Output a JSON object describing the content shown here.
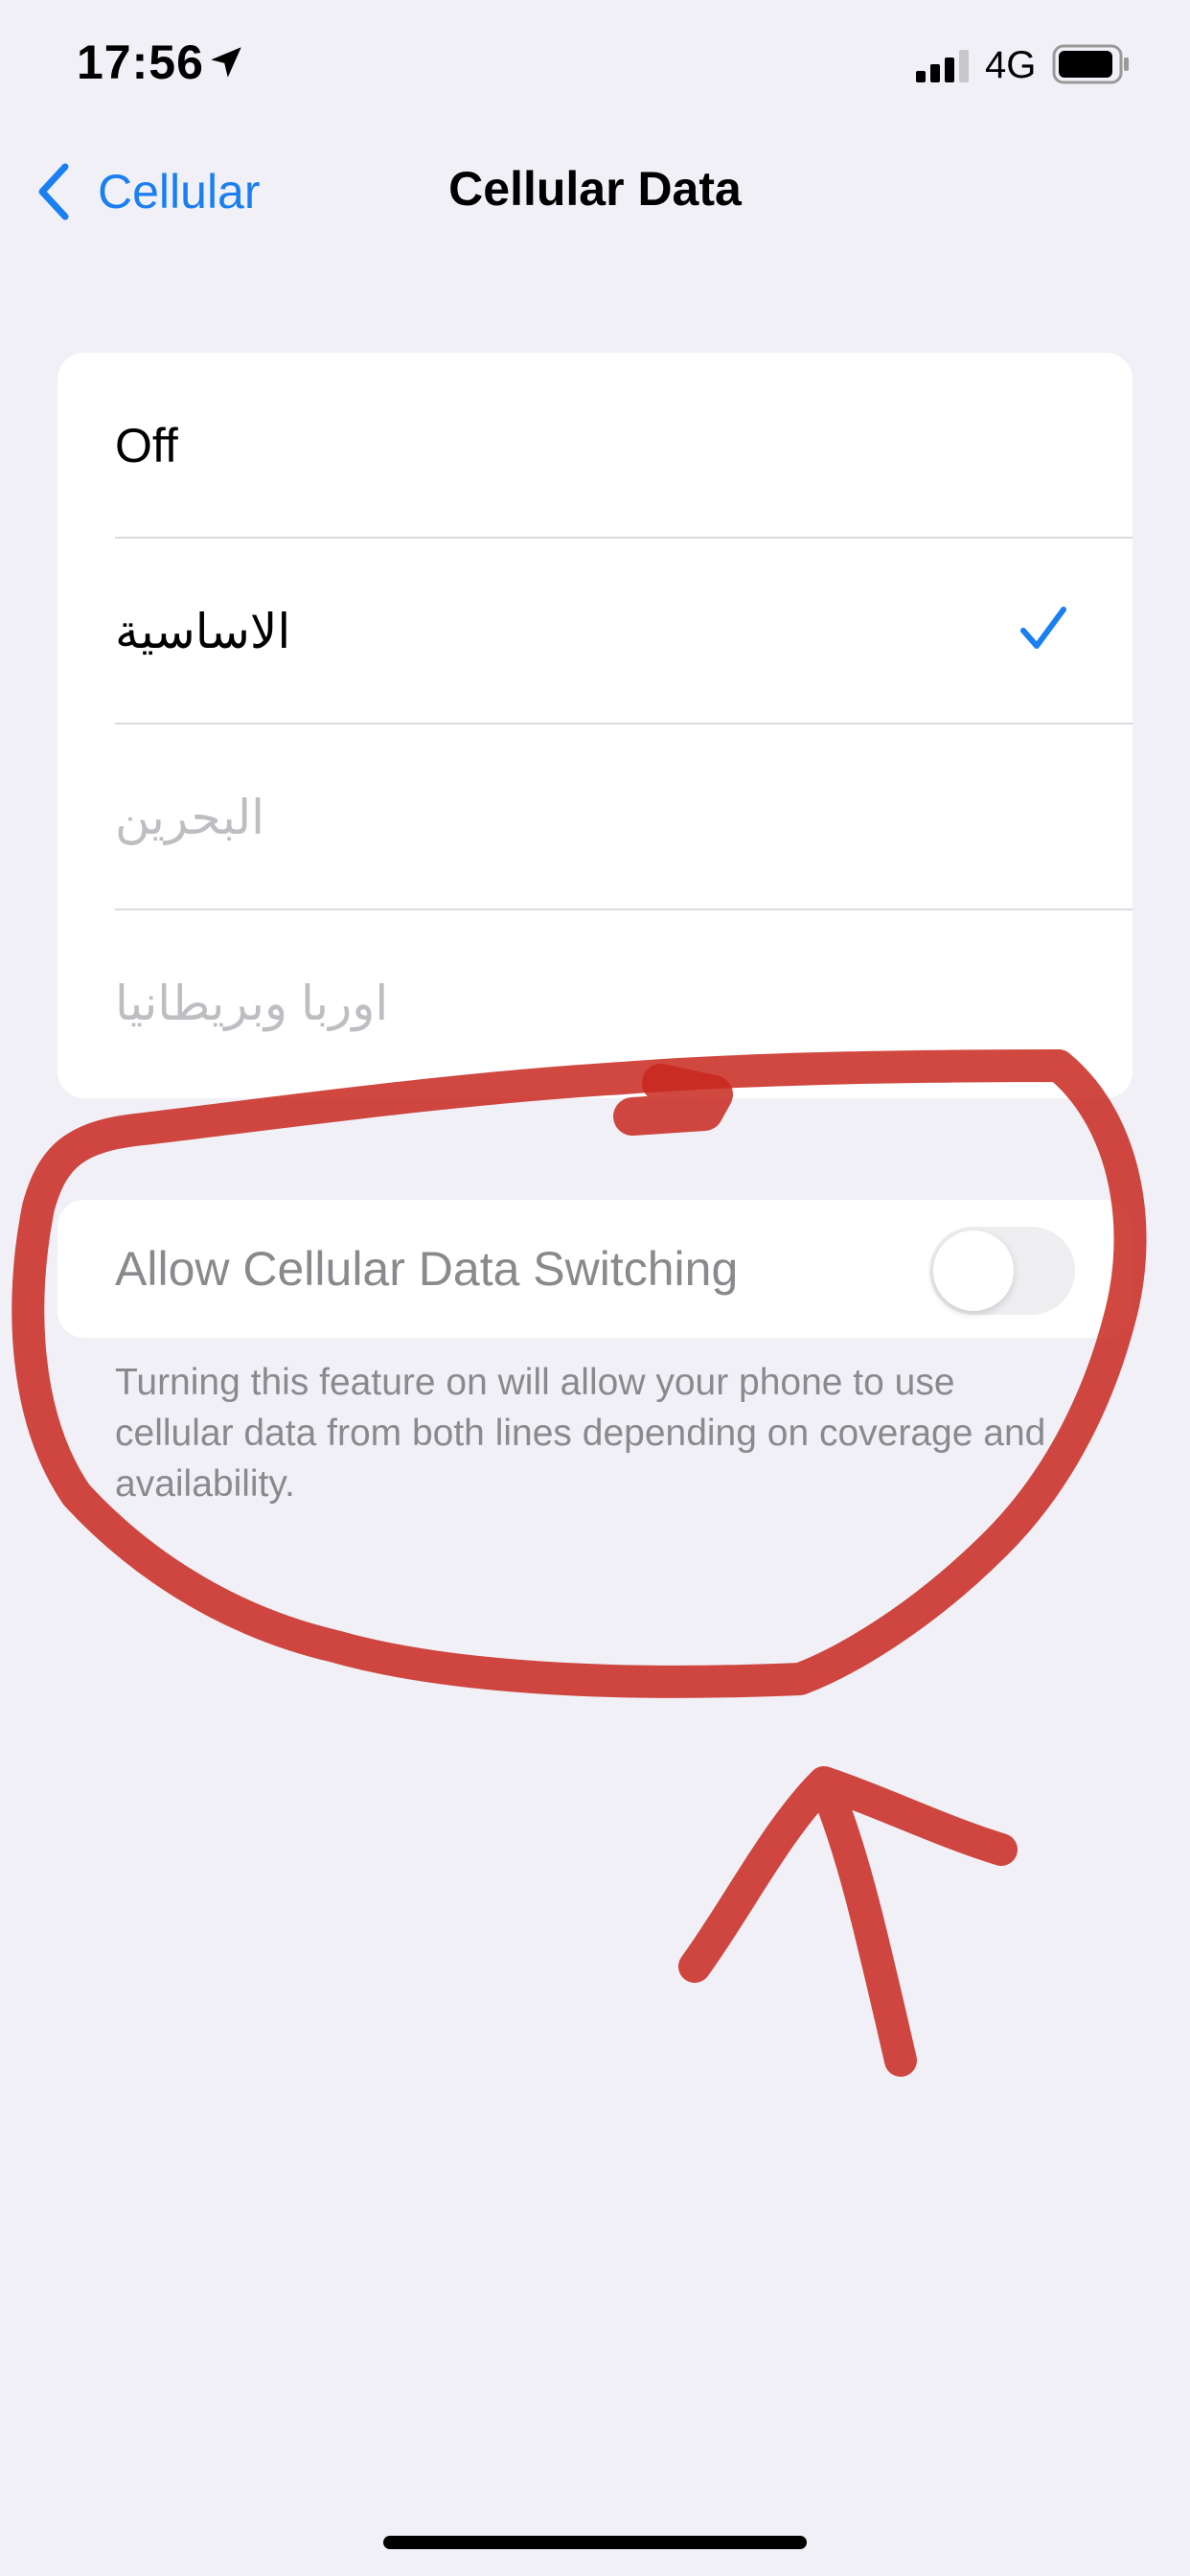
{
  "status_bar": {
    "time": "17:56",
    "network": "4G",
    "icons": [
      "location-arrow-icon",
      "cellular-signal-icon",
      "battery-icon"
    ]
  },
  "nav": {
    "back_label": "Cellular",
    "title": "Cellular Data"
  },
  "options": [
    {
      "label": "Off",
      "selected": false,
      "enabled": true
    },
    {
      "label": "الاساسية",
      "selected": true,
      "enabled": true
    },
    {
      "label": "البحرين",
      "selected": false,
      "enabled": false
    },
    {
      "label": "اوربا وبريطانيا",
      "selected": false,
      "enabled": false
    }
  ],
  "data_switching": {
    "label": "Allow Cellular Data Switching",
    "enabled": false,
    "footer": "Turning this feature on will allow your phone to use cellular data from both lines depending on coverage and availability."
  },
  "colors": {
    "background": "#f1f0f6",
    "accent": "#1a7ff0",
    "annotation": "#c8281e"
  }
}
